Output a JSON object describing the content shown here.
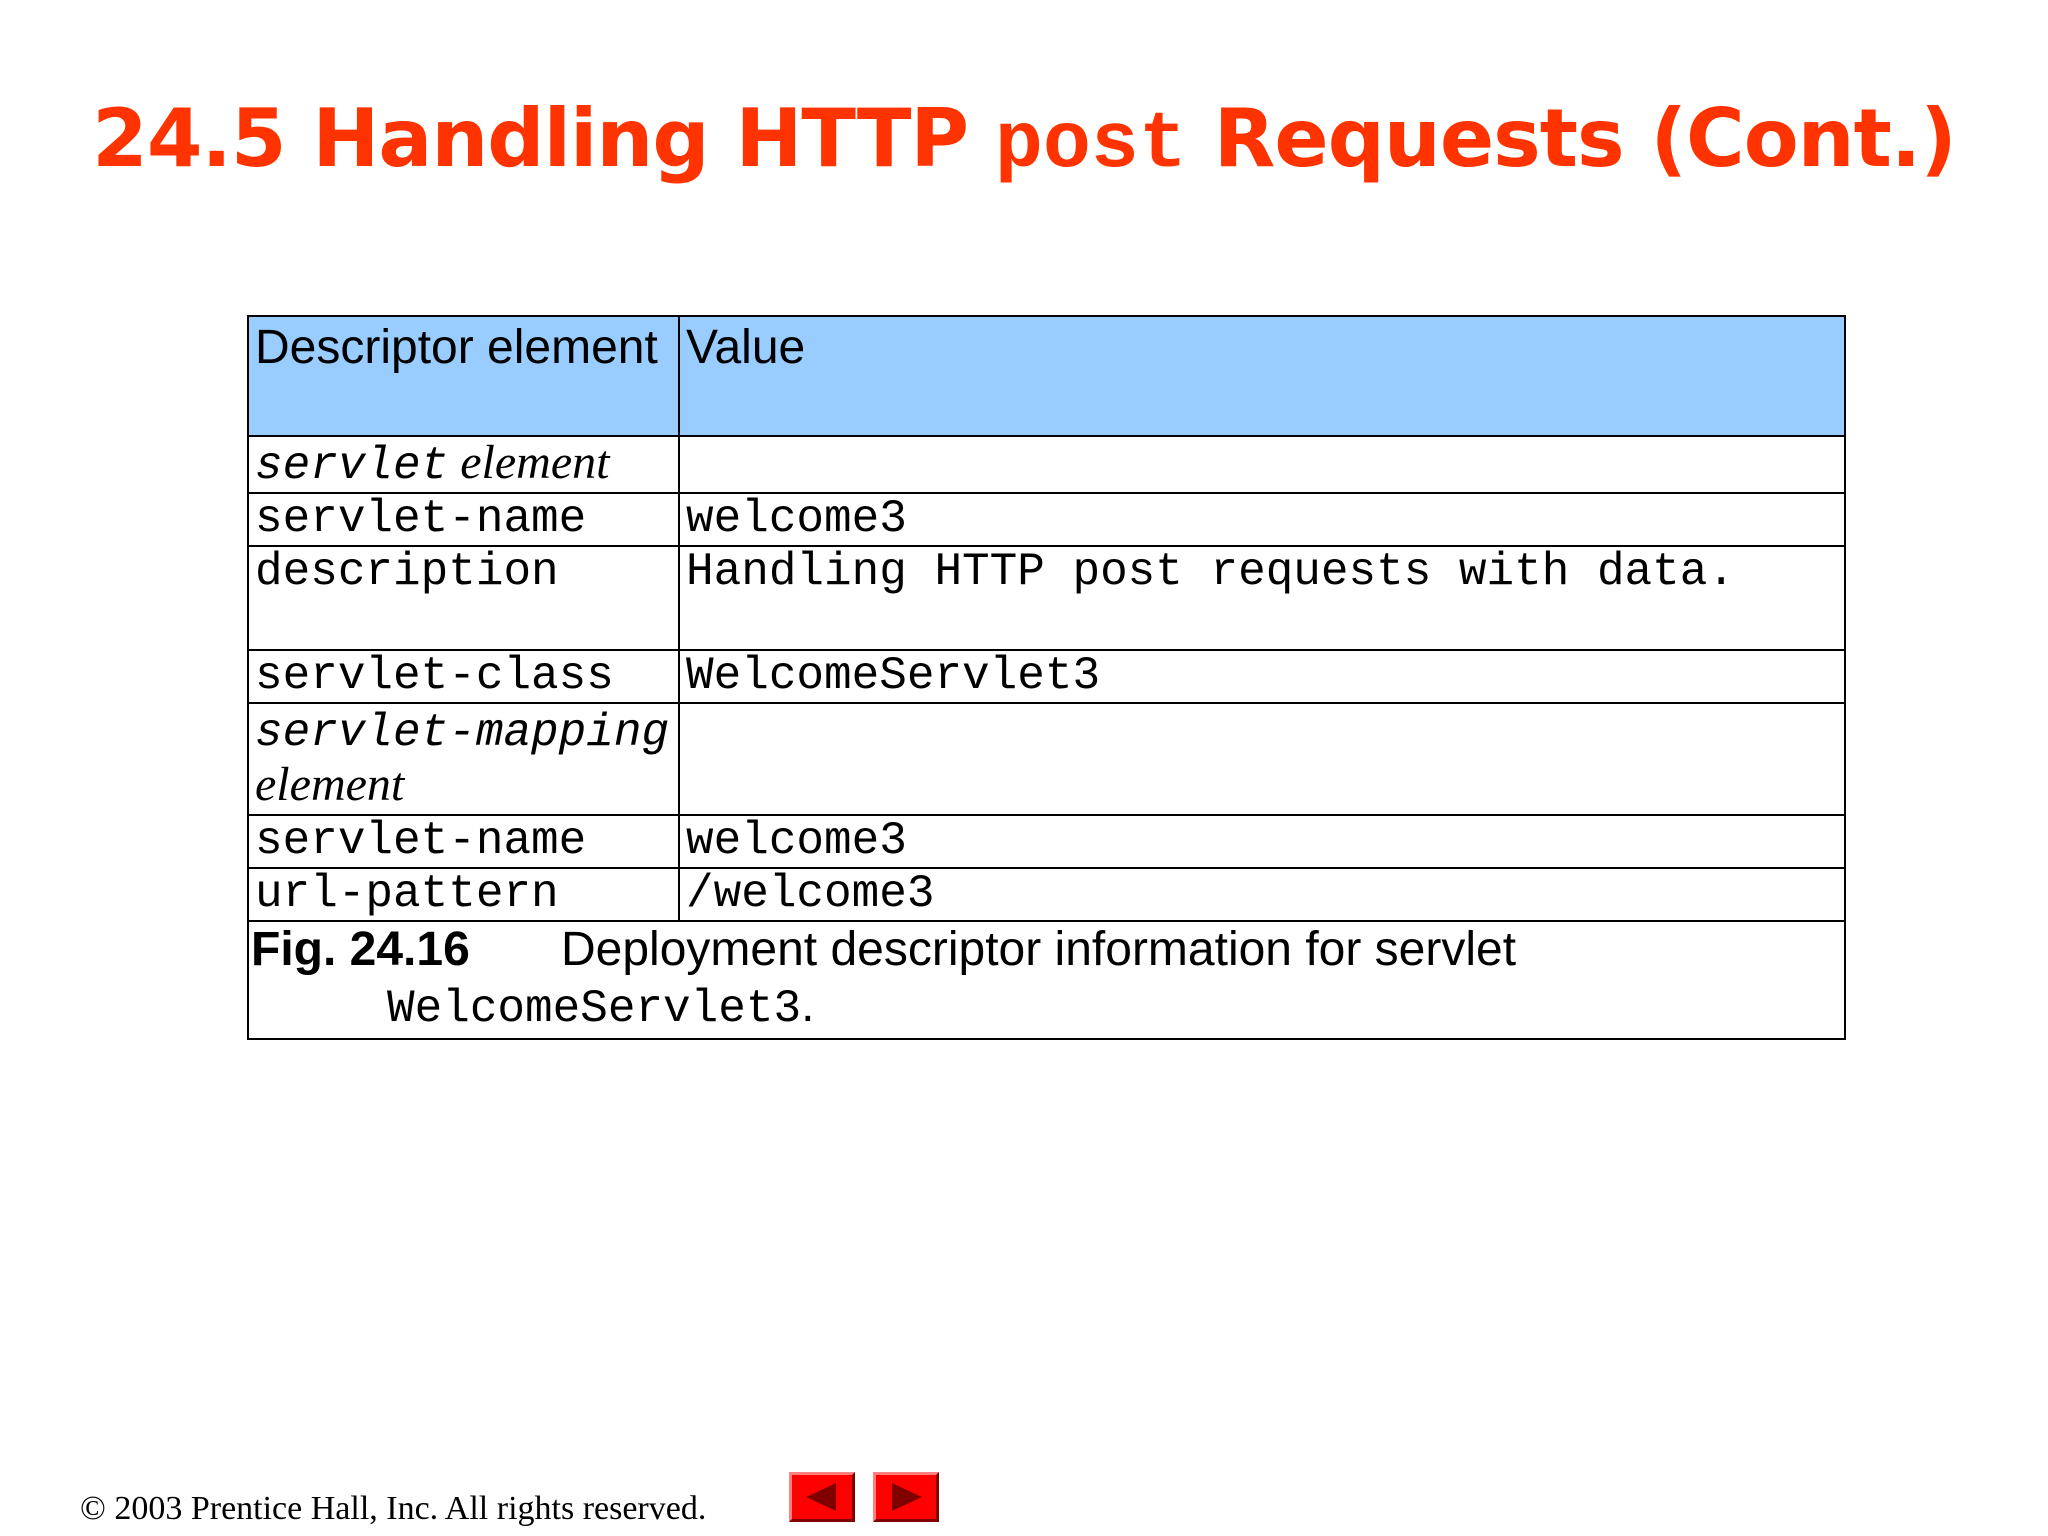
{
  "slide": {
    "title_part1": "24.5 Handling HTTP ",
    "title_code": "post",
    "title_part2": " Requests (Cont.)"
  },
  "table": {
    "headers": [
      "Descriptor element",
      "Value"
    ],
    "rows": [
      {
        "c1_code": "servlet",
        "c1_text": " element",
        "c2": ""
      },
      {
        "c1": "servlet-name",
        "c2": "welcome3"
      },
      {
        "c1": "description",
        "c2": "Handling HTTP post requests with data."
      },
      {
        "c1": "servlet-class",
        "c2": "WelcomeServlet3"
      },
      {
        "c1_code": "servlet-mapping",
        "c1_text": " element",
        "c2": ""
      },
      {
        "c1": "servlet-name",
        "c2": "welcome3"
      },
      {
        "c1": "url-pattern",
        "c2": "/welcome3"
      }
    ],
    "caption": {
      "label": "Fig. 24.16",
      "text": "Deployment descriptor information for servlet",
      "code": "WelcomeServlet3",
      "end": "."
    }
  },
  "footer": {
    "copyright": "© 2003 Prentice Hall, Inc.  All rights reserved."
  },
  "icons": {
    "prev": "left-arrow-icon",
    "next": "right-arrow-icon"
  },
  "colors": {
    "title": "#ff3300",
    "header_bg": "#99ccff",
    "nav_button": "#ff0000"
  }
}
